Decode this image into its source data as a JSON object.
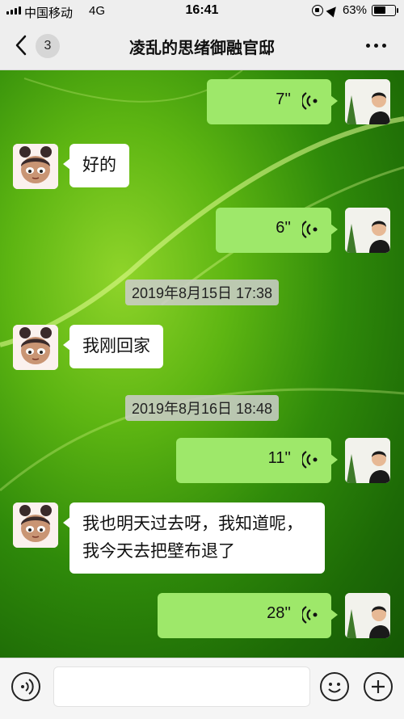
{
  "status_bar": {
    "carrier": "中国移动",
    "network": "4G",
    "time": "16:41",
    "battery": "63%",
    "battery_level": 0.63
  },
  "nav": {
    "unread_count": "3",
    "title": "凌乱的思绪御融官邸"
  },
  "messages": [
    {
      "side": "out",
      "type": "voice",
      "duration": "7''"
    },
    {
      "side": "in",
      "type": "text",
      "text": "好的"
    },
    {
      "side": "out",
      "type": "voice",
      "duration": "6''"
    },
    {
      "type": "timestamp",
      "text": "2019年8月15日 17:38"
    },
    {
      "side": "in",
      "type": "text",
      "text": "我刚回家"
    },
    {
      "type": "timestamp",
      "text": "2019年8月16日 18:48"
    },
    {
      "side": "out",
      "type": "voice",
      "duration": "11''"
    },
    {
      "side": "in",
      "type": "text",
      "text": "我也明天过去呀，我知道呢，我今天去把壁布退了"
    },
    {
      "side": "out",
      "type": "voice",
      "duration": "28''"
    }
  ],
  "colors": {
    "outgoing_bubble": "#9ee86a",
    "incoming_bubble": "#ffffff",
    "chat_background": "#2f8a0a"
  }
}
